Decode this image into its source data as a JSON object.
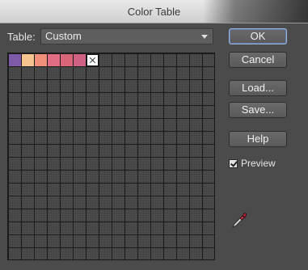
{
  "window": {
    "title": "Color Table"
  },
  "table": {
    "label": "Table:",
    "selected": "Custom"
  },
  "swatches": [
    "#7e5aa8",
    "#f5c38e",
    "#f0907a",
    "#e36c85",
    "#d9657a",
    "#cf6283"
  ],
  "buttons": {
    "ok": "OK",
    "cancel": "Cancel",
    "load": "Load...",
    "save": "Save...",
    "help": "Help"
  },
  "preview": {
    "label": "Preview",
    "checked": true
  },
  "icons": {
    "eyedropper": "eyedropper-icon",
    "chevron": "chevron-down-icon"
  }
}
